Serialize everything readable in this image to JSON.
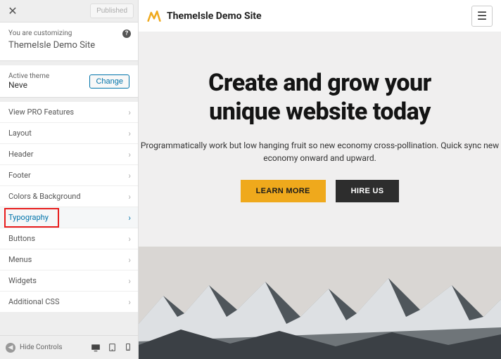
{
  "sidebar": {
    "publish_label": "Published",
    "you_are_customizing": "You are customizing",
    "site_title": "ThemeIsle Demo Site",
    "active_theme_label": "Active theme",
    "active_theme_name": "Neve",
    "change_label": "Change",
    "menu_items": [
      {
        "label": "View PRO Features",
        "active": false,
        "highlighted": false
      },
      {
        "label": "Layout",
        "active": false,
        "highlighted": false
      },
      {
        "label": "Header",
        "active": false,
        "highlighted": false
      },
      {
        "label": "Footer",
        "active": false,
        "highlighted": false
      },
      {
        "label": "Colors & Background",
        "active": false,
        "highlighted": false
      },
      {
        "label": "Typography",
        "active": true,
        "highlighted": true
      },
      {
        "label": "Buttons",
        "active": false,
        "highlighted": false
      },
      {
        "label": "Menus",
        "active": false,
        "highlighted": false
      },
      {
        "label": "Widgets",
        "active": false,
        "highlighted": false
      },
      {
        "label": "Additional CSS",
        "active": false,
        "highlighted": false
      }
    ],
    "hide_controls": "Hide Controls"
  },
  "preview": {
    "brand": "ThemeIsle Demo Site",
    "hero_title_line1": "Create and grow your",
    "hero_title_line2": "unique website today",
    "hero_sub_line1": "Programmatically work but low hanging fruit so new economy cross-pollination. Quick sync new",
    "hero_sub_line2": "economy onward and upward.",
    "btn_primary": "LEARN MORE",
    "btn_secondary": "HIRE US"
  },
  "colors": {
    "accent": "#0073aa",
    "highlight_border": "#e81c1c",
    "cta_primary": "#efa91c",
    "cta_secondary": "#2d2d2d"
  }
}
